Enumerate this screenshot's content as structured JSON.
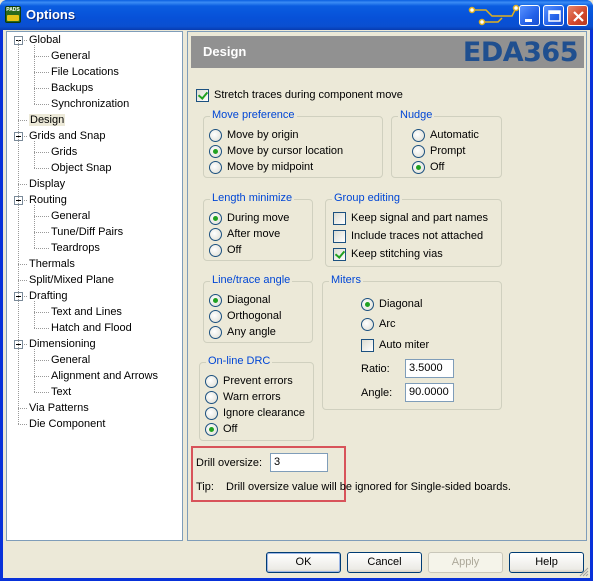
{
  "window": {
    "title": "Options",
    "app_icon_text": "PADS",
    "colors": {
      "titlebar": "#0a5de0",
      "accent_label": "#0046d5",
      "highlight": "#d8535a"
    }
  },
  "tree": {
    "items": [
      {
        "label": "Global",
        "expander": true
      },
      {
        "label": "General"
      },
      {
        "label": "File Locations"
      },
      {
        "label": "Backups"
      },
      {
        "label": "Synchronization"
      },
      {
        "label": "Design",
        "selected": true
      },
      {
        "label": "Grids and Snap",
        "expander": true
      },
      {
        "label": "Grids"
      },
      {
        "label": "Object Snap"
      },
      {
        "label": "Display"
      },
      {
        "label": "Routing",
        "expander": true
      },
      {
        "label": "General"
      },
      {
        "label": "Tune/Diff Pairs"
      },
      {
        "label": "Teardrops"
      },
      {
        "label": "Thermals"
      },
      {
        "label": "Split/Mixed Plane"
      },
      {
        "label": "Drafting",
        "expander": true
      },
      {
        "label": "Text and Lines"
      },
      {
        "label": "Hatch and Flood"
      },
      {
        "label": "Dimensioning",
        "expander": true
      },
      {
        "label": "General"
      },
      {
        "label": "Alignment and Arrows"
      },
      {
        "label": "Text"
      },
      {
        "label": "Via Patterns"
      },
      {
        "label": "Die Component"
      }
    ]
  },
  "panel": {
    "title": "Design",
    "logo": "EDA365",
    "stretch_traces": {
      "label": "Stretch traces during component move",
      "checked": true
    },
    "move_preference": {
      "label": "Move preference",
      "options": [
        "Move by origin",
        "Move by cursor location",
        "Move by midpoint"
      ],
      "selected": 1
    },
    "nudge": {
      "label": "Nudge",
      "options": [
        "Automatic",
        "Prompt",
        "Off"
      ],
      "selected": 2
    },
    "length_minimize": {
      "label": "Length minimize",
      "options": [
        "During move",
        "After move",
        "Off"
      ],
      "selected": 0
    },
    "group_editing": {
      "label": "Group editing",
      "options": [
        {
          "label": "Keep signal and part names",
          "checked": false
        },
        {
          "label": "Include traces not attached",
          "checked": false
        },
        {
          "label": "Keep stitching vias",
          "checked": true
        }
      ]
    },
    "line_trace_angle": {
      "label": "Line/trace angle",
      "options": [
        "Diagonal",
        "Orthogonal",
        "Any angle"
      ],
      "selected": 0
    },
    "miters": {
      "label": "Miters",
      "options": [
        "Diagonal",
        "Arc"
      ],
      "selected": 0,
      "auto_miter": {
        "label": "Auto miter",
        "checked": false
      },
      "ratio_label": "Ratio:",
      "ratio_value": "3.5000",
      "angle_label": "Angle:",
      "angle_value": "90.0000"
    },
    "online_drc": {
      "label": "On-line DRC",
      "options": [
        "Prevent errors",
        "Warn errors",
        "Ignore clearance",
        "Off"
      ],
      "selected": 3
    },
    "drill_oversize": {
      "label": "Drill oversize:",
      "value": "3",
      "tip_label": "Tip:",
      "tip_text": "Drill oversize value will be ignored for Single-sided boards."
    }
  },
  "buttons": {
    "ok": "OK",
    "cancel": "Cancel",
    "apply": "Apply",
    "help": "Help"
  }
}
